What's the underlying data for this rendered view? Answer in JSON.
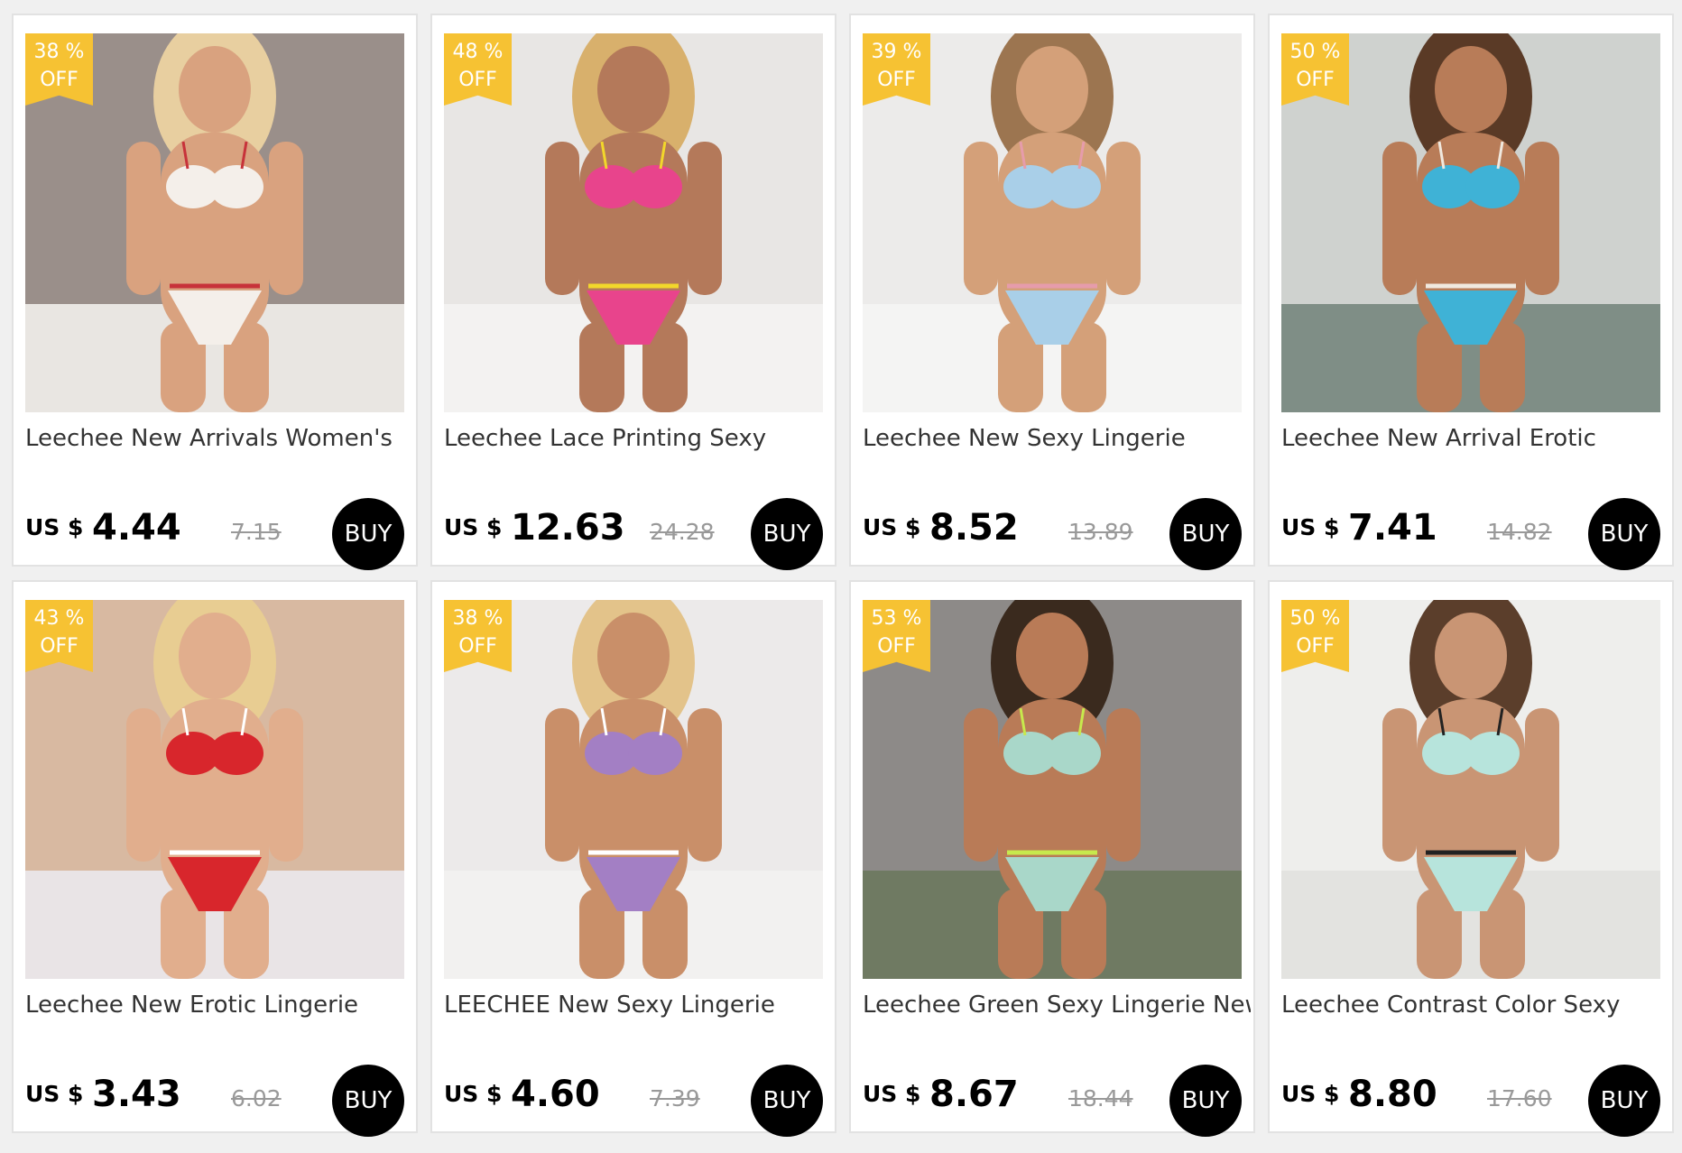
{
  "products": [
    {
      "discount_pct": "38 %",
      "discount_off": "OFF",
      "title": "Leechee New Arrivals Women's",
      "currency": "US $",
      "price": "4.44",
      "original_price": "7.15",
      "buy_label": "BUY",
      "photo": {
        "bg": "#9a8f8a",
        "floor": "#e9e6e2",
        "skin": "#d9a27f",
        "hair": "#e8cfa0",
        "garment": "#f4efea",
        "accent": "#c7323a"
      }
    },
    {
      "discount_pct": "48 %",
      "discount_off": "OFF",
      "title": "Leechee Lace Printing Sexy",
      "currency": "US $",
      "price": "12.63",
      "original_price": "24.28",
      "buy_label": "BUY",
      "photo": {
        "bg": "#e8e6e4",
        "floor": "#f3f2f1",
        "skin": "#b4795a",
        "hair": "#d8b06c",
        "garment": "#e8448c",
        "accent": "#f2d72b"
      }
    },
    {
      "discount_pct": "39 %",
      "discount_off": "OFF",
      "title": "Leechee New Sexy Lingerie",
      "currency": "US $",
      "price": "8.52",
      "original_price": "13.89",
      "buy_label": "BUY",
      "photo": {
        "bg": "#ecebea",
        "floor": "#f4f4f3",
        "skin": "#d4a079",
        "hair": "#9c7550",
        "garment": "#a9cfe8",
        "accent": "#e69cab"
      }
    },
    {
      "discount_pct": "50 %",
      "discount_off": "OFF",
      "title": "Leechee New Arrival Erotic",
      "currency": "US $",
      "price": "7.41",
      "original_price": "14.82",
      "buy_label": "BUY",
      "photo": {
        "bg": "#cfd2cf",
        "floor": "#7f8e86",
        "skin": "#b87c58",
        "hair": "#5a3a26",
        "garment": "#3fb2d6",
        "accent": "#f0e9df"
      }
    },
    {
      "discount_pct": "43 %",
      "discount_off": "OFF",
      "title": "Leechee New Erotic Lingerie",
      "currency": "US $",
      "price": "3.43",
      "original_price": "6.02",
      "buy_label": "BUY",
      "photo": {
        "bg": "#d8b9a1",
        "floor": "#e9e4e6",
        "skin": "#e1ae8d",
        "hair": "#e8cd92",
        "garment": "#d8262c",
        "accent": "#ffffff"
      }
    },
    {
      "discount_pct": "38 %",
      "discount_off": "OFF",
      "title": "LEECHEE New Sexy Lingerie",
      "currency": "US $",
      "price": "4.60",
      "original_price": "7.39",
      "buy_label": "BUY",
      "photo": {
        "bg": "#eceaea",
        "floor": "#f2f1f0",
        "skin": "#c98f69",
        "hair": "#e3c38a",
        "garment": "#a37fc4",
        "accent": "#ffffff"
      }
    },
    {
      "discount_pct": "53 %",
      "discount_off": "OFF",
      "title": "Leechee Green Sexy Lingerie New",
      "currency": "US $",
      "price": "8.67",
      "original_price": "18.44",
      "buy_label": "BUY",
      "photo": {
        "bg": "#8d8a88",
        "floor": "#6f7a62",
        "skin": "#b97b57",
        "hair": "#3a2a1e",
        "garment": "#a9d7c9",
        "accent": "#c7e94d"
      }
    },
    {
      "discount_pct": "50 %",
      "discount_off": "OFF",
      "title": "Leechee Contrast Color Sexy",
      "currency": "US $",
      "price": "8.80",
      "original_price": "17.60",
      "buy_label": "BUY",
      "photo": {
        "bg": "#eeeeec",
        "floor": "#e3e3e0",
        "skin": "#c99574",
        "hair": "#5b3e2b",
        "garment": "#b7e4dc",
        "accent": "#222222"
      }
    }
  ]
}
